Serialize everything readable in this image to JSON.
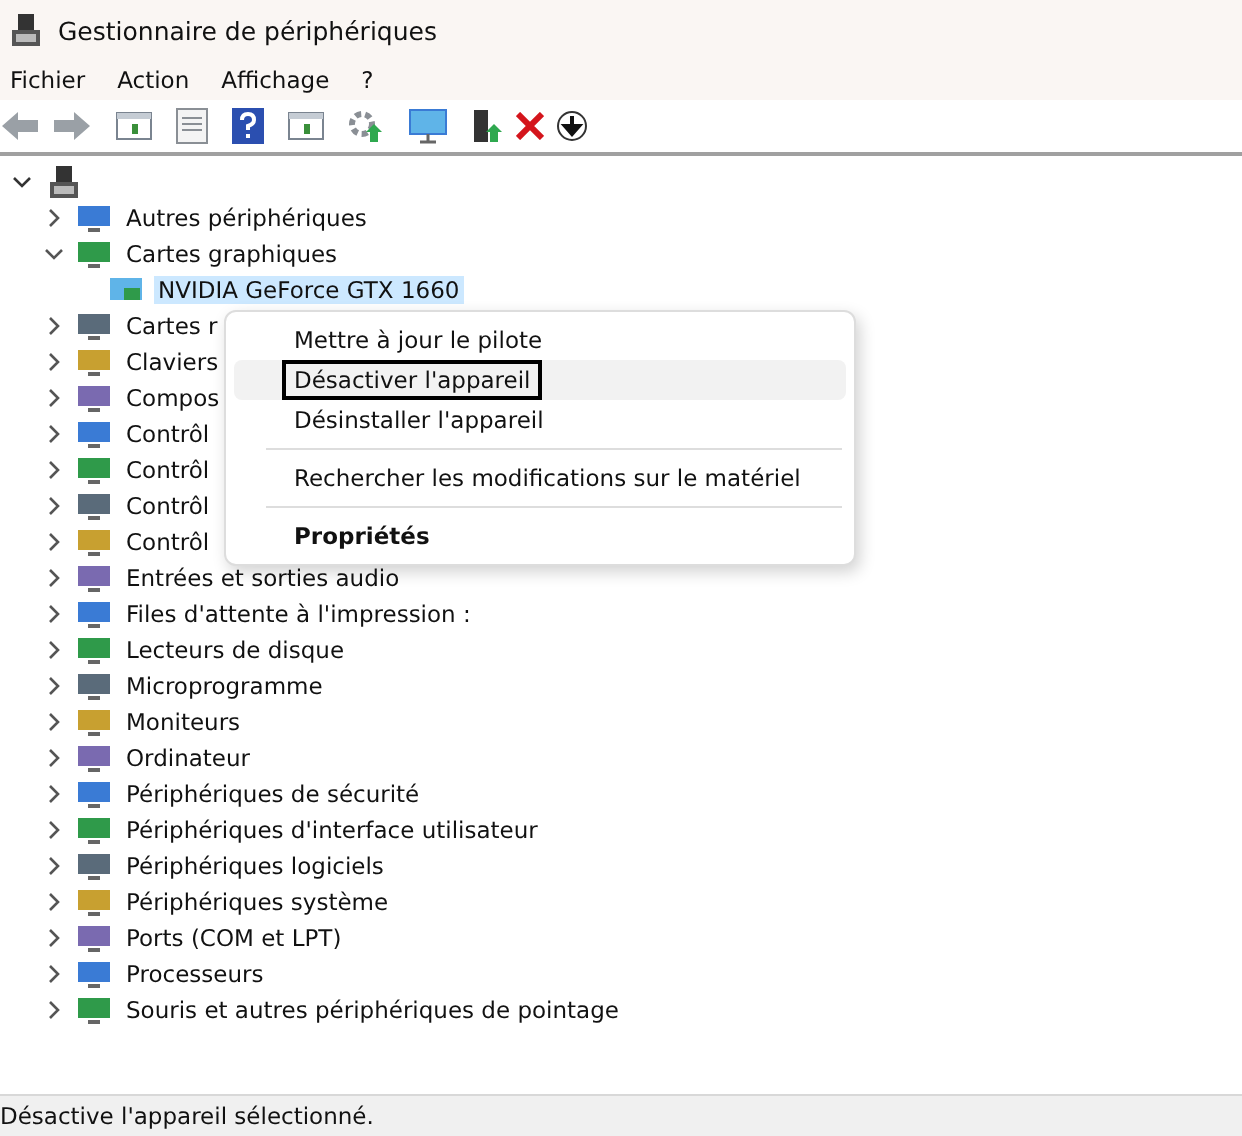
{
  "window": {
    "title": "Gestionnaire de périphériques"
  },
  "menu_bar": [
    "Fichier",
    "Action",
    "Affichage",
    "?"
  ],
  "tree": {
    "expanded": true,
    "children": [
      {
        "label": "Autres périphériques",
        "expanded": false
      },
      {
        "label": "Cartes graphiques",
        "expanded": true,
        "children": [
          {
            "label": "NVIDIA GeForce GTX 1660",
            "selected": true
          }
        ]
      },
      {
        "label": "Cartes r",
        "expanded": false
      },
      {
        "label": "Claviers",
        "expanded": false
      },
      {
        "label": "Compos",
        "expanded": false
      },
      {
        "label": "Contrôl",
        "expanded": false
      },
      {
        "label": "Contrôl",
        "expanded": false
      },
      {
        "label": "Contrôl",
        "expanded": false
      },
      {
        "label": "Contrôl",
        "expanded": false
      },
      {
        "label": "Entrées et sorties audio",
        "expanded": false
      },
      {
        "label": "Files d'attente à l'impression :",
        "expanded": false
      },
      {
        "label": "Lecteurs de disque",
        "expanded": false
      },
      {
        "label": "Microprogramme",
        "expanded": false
      },
      {
        "label": "Moniteurs",
        "expanded": false
      },
      {
        "label": "Ordinateur",
        "expanded": false
      },
      {
        "label": "Périphériques de sécurité",
        "expanded": false
      },
      {
        "label": "Périphériques d'interface utilisateur",
        "expanded": false
      },
      {
        "label": "Périphériques logiciels",
        "expanded": false
      },
      {
        "label": "Périphériques système",
        "expanded": false
      },
      {
        "label": "Ports (COM et LPT)",
        "expanded": false
      },
      {
        "label": "Processeurs",
        "expanded": false
      },
      {
        "label": "Souris et autres périphériques de pointage",
        "expanded": false
      }
    ]
  },
  "context_menu": [
    {
      "kind": "item",
      "label": "Mettre à jour le pilote",
      "selected": false
    },
    {
      "kind": "item",
      "label": "Désactiver l'appareil",
      "selected": true
    },
    {
      "kind": "item",
      "label": "Désinstaller l'appareil",
      "selected": false
    },
    {
      "kind": "separator"
    },
    {
      "kind": "item",
      "label": "Rechercher les modifications sur le matériel",
      "selected": false
    },
    {
      "kind": "separator"
    },
    {
      "kind": "default",
      "label": "Propriétés",
      "selected": false
    }
  ],
  "status_bar": "Désactive l'appareil sélectionné."
}
